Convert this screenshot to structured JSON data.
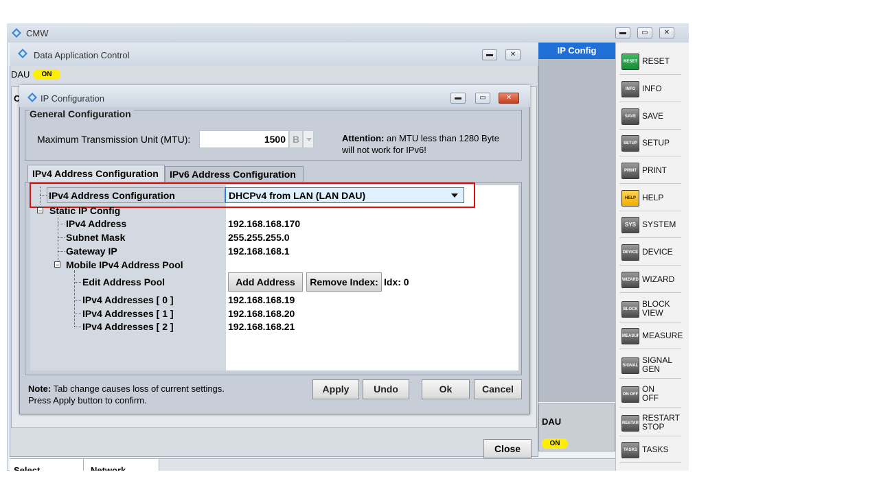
{
  "main_window": {
    "title": "CMW"
  },
  "dac_window": {
    "title": "Data Application Control",
    "dau_label": "DAU",
    "dau_status": "ON",
    "close_label": "Close",
    "partial_left": "C"
  },
  "ip_dialog": {
    "title": "IP Configuration",
    "general": {
      "heading": "General Configuration",
      "mtu_label": "Maximum Transmission Unit (MTU):",
      "mtu_value": "1500",
      "mtu_unit": "B",
      "attention_bold": "Attention:",
      "attention_text": " an MTU less than 1280 Byte",
      "attention_text2": "will not work for IPv6!"
    },
    "tabs": [
      {
        "label": "IPv4 Address Configuration"
      },
      {
        "label": "IPv6 Address Configuration"
      }
    ],
    "tree": {
      "selected_label": "IPv4 Address Configuration",
      "selected_value": "DHCPv4 from LAN (LAN DAU)",
      "static_label": "Static IP Config",
      "ipv4_address_label": "IPv4 Address",
      "ipv4_address_value": "192.168.168.170",
      "subnet_label": "Subnet Mask",
      "subnet_value": "255.255.255.0",
      "gateway_label": "Gateway IP",
      "gateway_value": "192.168.168.1",
      "pool_label": "Mobile IPv4 Address Pool",
      "edit_pool_label": "Edit Address Pool",
      "add_address_label": "Add Address",
      "remove_index_label": "Remove Index:",
      "idx_text": "Idx: 0",
      "pool_items": [
        {
          "label": "IPv4 Addresses [ 0 ]",
          "value": "192.168.168.19"
        },
        {
          "label": "IPv4 Addresses [ 1 ]",
          "value": "192.168.168.20"
        },
        {
          "label": "IPv4 Addresses [ 2 ]",
          "value": "192.168.168.21"
        }
      ]
    },
    "note_bold": "Note:",
    "note_text": " Tab change causes loss of current settings.",
    "note_text2": "Press Apply button to confirm.",
    "buttons": {
      "apply": "Apply",
      "undo": "Undo",
      "ok": "Ok",
      "cancel": "Cancel"
    }
  },
  "right_panel": {
    "ip_config": "IP Config",
    "dau_label": "DAU",
    "dau_status": "ON"
  },
  "bottom_tabs": {
    "select": "Select",
    "network": "Network"
  },
  "softkeys": [
    {
      "icon": "RESET",
      "label": "RESET",
      "icon_name": "reset-icon"
    },
    {
      "icon": "INFO",
      "label": "INFO",
      "icon_name": "info-icon"
    },
    {
      "icon": "SAVE RCL",
      "label": "SAVE",
      "icon_name": "save-icon"
    },
    {
      "icon": "SETUP",
      "label": "SETUP",
      "icon_name": "setup-icon"
    },
    {
      "icon": "PRINT",
      "label": "PRINT",
      "icon_name": "print-icon"
    },
    {
      "icon": "HELP",
      "label": "HELP",
      "icon_name": "help-icon"
    },
    {
      "icon": "SYS",
      "label": "SYSTEM",
      "icon_name": "system-icon"
    },
    {
      "icon": "DEVICE",
      "label": "DEVICE",
      "icon_name": "device-icon"
    },
    {
      "icon": "WIZARD",
      "label": "WIZARD",
      "icon_name": "wizard-icon"
    },
    {
      "icon": "BLOCK VIEW",
      "label": "BLOCK",
      "label2": "VIEW",
      "icon_name": "block-view-icon"
    },
    {
      "icon": "MEASURE",
      "label": "MEASURE",
      "icon_name": "measure-icon"
    },
    {
      "icon": "SIGNAL GEN",
      "label": "SIGNAL",
      "label2": "GEN",
      "icon_name": "signal-gen-icon"
    },
    {
      "icon": "ON OFF",
      "label": "ON",
      "label2": "OFF",
      "icon_name": "on-off-icon"
    },
    {
      "icon": "RESTART STOP",
      "label": "RESTART",
      "label2": "STOP",
      "icon_name": "restart-stop-icon"
    },
    {
      "icon": "TASKS",
      "label": "TASKS",
      "icon_name": "tasks-icon"
    }
  ],
  "colors": {
    "accent_blue": "#1f6fd6",
    "status_yellow": "#ffee00",
    "highlight_red": "#e01010",
    "help_orange": "#f0b000",
    "reset_green": "#1a8a3a"
  }
}
